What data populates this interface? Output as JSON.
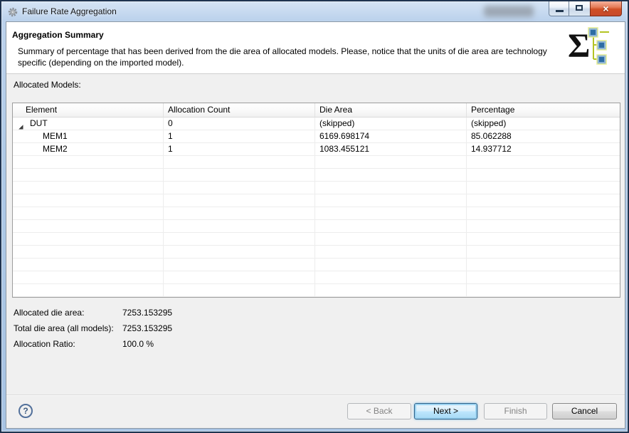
{
  "window": {
    "title": "Failure Rate Aggregation",
    "controls": {
      "minimize": "minimize-icon",
      "maximize": "maximize-icon",
      "close": "close-icon"
    }
  },
  "header": {
    "title": "Aggregation Summary",
    "description": "Summary of percentage that has been derived from the die area of allocated models. Please, notice that the units of die area are technology specific (depending on the imported model)."
  },
  "main": {
    "allocated_models_label": "Allocated Models:",
    "table": {
      "columns": [
        "Element",
        "Allocation Count",
        "Die Area",
        "Percentage"
      ],
      "rows": [
        {
          "element": "DUT",
          "allocation_count": "0",
          "die_area": "(skipped)",
          "percentage": "(skipped)",
          "level": 0,
          "expanded": true
        },
        {
          "element": "MEM1",
          "allocation_count": "1",
          "die_area": "6169.698174",
          "percentage": "85.062288",
          "level": 1,
          "expanded": false
        },
        {
          "element": "MEM2",
          "allocation_count": "1",
          "die_area": "1083.455121",
          "percentage": "14.937712",
          "level": 1,
          "expanded": false
        }
      ],
      "empty_rows": 11
    },
    "summary": [
      {
        "label": "Allocated die area:",
        "value": "7253.153295"
      },
      {
        "label": "Total die area (all models):",
        "value": "7253.153295"
      },
      {
        "label": "Allocation Ratio:",
        "value": "100.0 %"
      }
    ]
  },
  "footer": {
    "help_icon": "?",
    "buttons": [
      {
        "label": "< Back",
        "state": "disabled"
      },
      {
        "label": "Next >",
        "state": "default"
      },
      {
        "label": "Finish",
        "state": "disabled"
      },
      {
        "label": "Cancel",
        "state": "enabled"
      }
    ]
  },
  "icons": {
    "titlebar": "gear-icon",
    "header_graphic": "sigma-tree-icon",
    "help": "question-mark-circle-icon",
    "tree_expander": "expanded-triangle-icon"
  },
  "colors": {
    "titlebar_gradient_top": "#d5e4f5",
    "titlebar_gradient_bottom": "#a7c3e3",
    "dialog_bg": "#f0f0f0",
    "header_bg": "#ffffff",
    "table_grid": "#ededed",
    "default_button_border": "#2c628b",
    "default_button_bg": "#bde6fd",
    "close_button_red": "#c64a2b",
    "disabled_text": "#838383"
  }
}
